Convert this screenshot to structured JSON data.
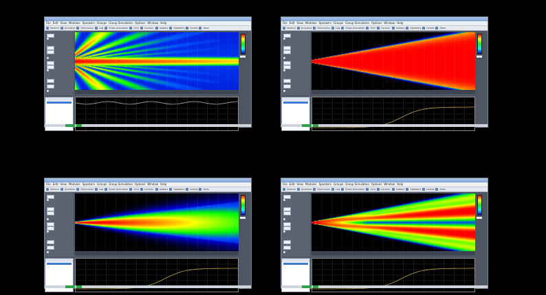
{
  "windows": [
    {
      "id": "top-left",
      "pattern": "beam-sidelobes",
      "menu": [
        "File",
        "Edit",
        "View",
        "Modules",
        "Speakers",
        "Groups",
        "Group Simulation",
        "Options",
        "Window",
        "Help"
      ],
      "toolbar": [
        "Normal",
        "Quantize",
        "Dimension",
        "Log",
        "Show animation",
        "Grid",
        "Contour",
        "Isobars",
        "Speakers",
        "Levels",
        "Axes"
      ]
    },
    {
      "id": "top-right",
      "pattern": "wide-cone",
      "menu": [
        "File",
        "Edit",
        "View",
        "Modules",
        "Speakers",
        "Groups",
        "Group Simulation",
        "Options",
        "Window",
        "Help"
      ],
      "toolbar": [
        "Normal",
        "Quantize",
        "Dimension",
        "Log",
        "Show animation",
        "Grid",
        "Contour",
        "Isobars",
        "Speakers",
        "Levels",
        "Axes"
      ]
    },
    {
      "id": "bottom-left",
      "pattern": "narrow-cone",
      "menu": [
        "File",
        "Edit",
        "View",
        "Modules",
        "Speakers",
        "Groups",
        "Group Simulation",
        "Options",
        "Window",
        "Help"
      ],
      "toolbar": [
        "Normal",
        "Quantize",
        "Dimension",
        "Log",
        "Show animation",
        "Grid",
        "Contour",
        "Isobars",
        "Speakers",
        "Levels",
        "Axes"
      ]
    },
    {
      "id": "bottom-right",
      "pattern": "split-lobes",
      "menu": [
        "File",
        "Edit",
        "View",
        "Modules",
        "Speakers",
        "Groups",
        "Group Simulation",
        "Options",
        "Window",
        "Help"
      ],
      "toolbar": [
        "Normal",
        "Quantize",
        "Dimension",
        "Log",
        "Show animation",
        "Grid",
        "Contour",
        "Isobars",
        "Speakers",
        "Levels",
        "Axes"
      ]
    }
  ],
  "colors": {
    "background": "#000000",
    "panel": "#4f5663",
    "red": "#ff0000",
    "yellow": "#ffff00",
    "green": "#00ff00",
    "blue": "#0000ff"
  }
}
